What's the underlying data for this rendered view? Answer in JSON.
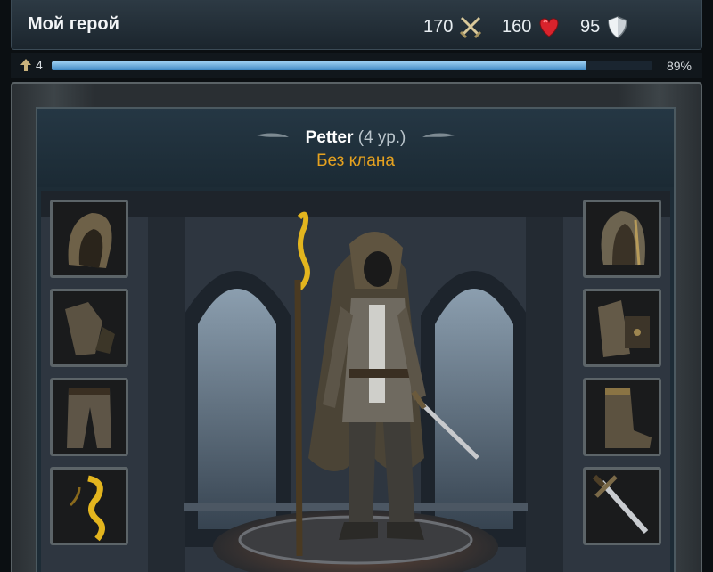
{
  "header": {
    "title": "Мой герой",
    "attack": "170",
    "health": "160",
    "defense": "95"
  },
  "level": {
    "value": "4",
    "progress_percent": 89,
    "progress_label": "89%"
  },
  "hero": {
    "name": "Petter",
    "level_label": "(4 ур.)",
    "clan": "Без клана"
  },
  "equipment_left": [
    "hood-icon",
    "gauntlet-icon",
    "legs-icon",
    "staff-icon"
  ],
  "equipment_right": [
    "armor-icon",
    "hand-armor-icon",
    "boots-icon",
    "sword-icon"
  ],
  "colors": {
    "clan": "#e6a21f",
    "progress": "#5fa8df",
    "health": "#d9232c"
  }
}
